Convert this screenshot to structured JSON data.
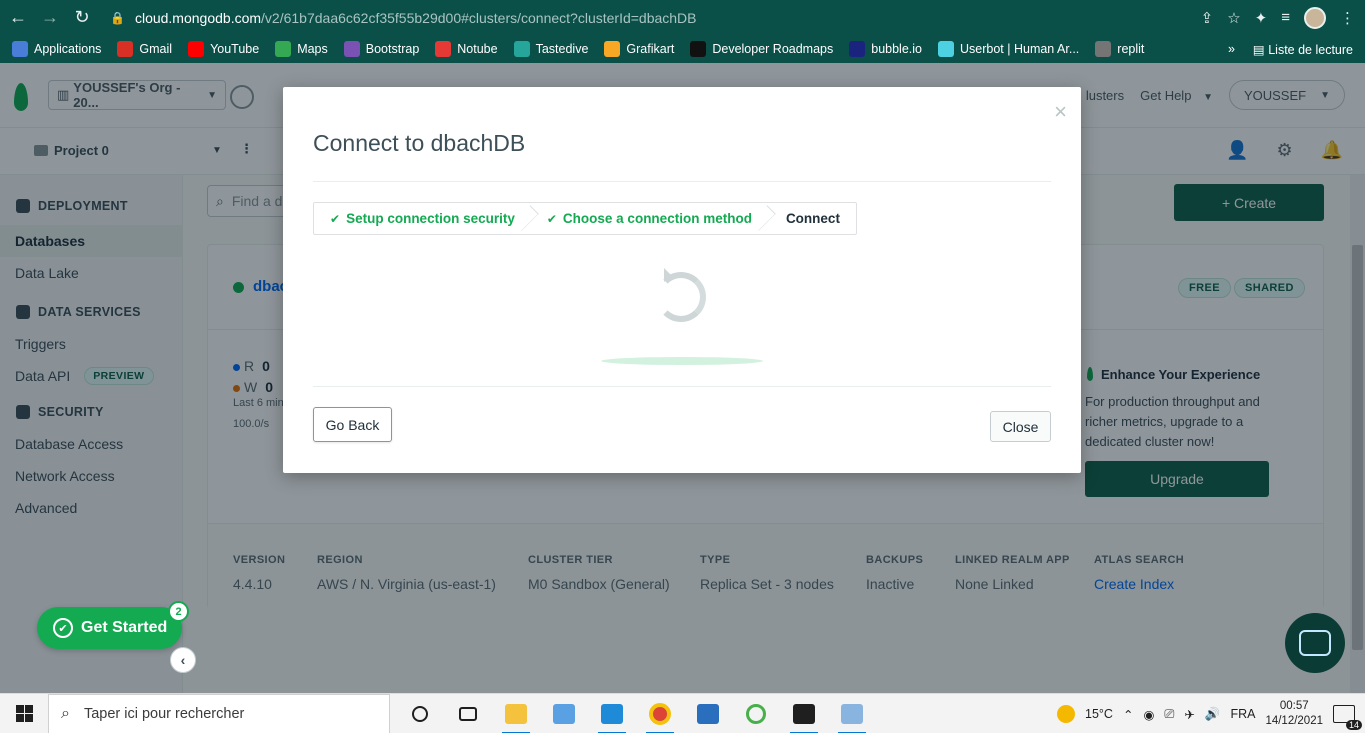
{
  "browser": {
    "url_host": "cloud.mongodb.com",
    "url_path": "/v2/61b7daa6c62cf35f55b29d00#clusters/connect?clusterId=dbachDB",
    "bookmarks": [
      {
        "label": "Applications",
        "color": "#4a7dd8"
      },
      {
        "label": "Gmail",
        "color": "#d93025"
      },
      {
        "label": "YouTube",
        "color": "#ff0000"
      },
      {
        "label": "Maps",
        "color": "#34a853"
      },
      {
        "label": "Bootstrap",
        "color": "#7952b3"
      },
      {
        "label": "Notube",
        "color": "#e53935"
      },
      {
        "label": "Tastedive",
        "color": "#26a69a"
      },
      {
        "label": "Grafikart",
        "color": "#f9a825"
      },
      {
        "label": "Developer Roadmaps",
        "color": "#111111"
      },
      {
        "label": "bubble.io",
        "color": "#1a237e"
      },
      {
        "label": "Userbot | Human Ar...",
        "color": "#4dd0e1"
      },
      {
        "label": "replit",
        "color": "#757575"
      }
    ],
    "reading_list": "Liste de lecture",
    "more": "»"
  },
  "header": {
    "org": "YOUSSEF's Org - 20...",
    "clusters_partial": "lusters",
    "get_help": "Get Help",
    "user": "YOUSSEF"
  },
  "project": {
    "name": "Project 0"
  },
  "sidebar": {
    "deployment": "DEPLOYMENT",
    "databases": "Databases",
    "data_lake": "Data Lake",
    "data_services": "DATA SERVICES",
    "triggers": "Triggers",
    "data_api": "Data API",
    "preview": "PREVIEW",
    "security": "SECURITY",
    "database_access": "Database Access",
    "network_access": "Network Access",
    "advanced": "Advanced"
  },
  "get_started": {
    "label": "Get Started",
    "count": "2"
  },
  "main": {
    "search_placeholder": "Find a d",
    "create": "Create",
    "cluster_name_partial": "dbac",
    "free": "FREE",
    "shared": "SHARED",
    "metric_r_label": "R",
    "metric_r_value": "0",
    "metric_w_label": "W",
    "metric_w_value": "0",
    "last_6": "Last 6 min",
    "rate": "100.0/s",
    "enhance_title": "Enhance Your Experience",
    "enhance_text": "For production throughput and richer metrics, upgrade to a dedicated cluster now!",
    "upgrade": "Upgrade",
    "footer": [
      {
        "key": "VERSION",
        "value": "4.4.10",
        "link": false
      },
      {
        "key": "REGION",
        "value": "AWS / N. Virginia (us-east-1)",
        "link": false
      },
      {
        "key": "CLUSTER TIER",
        "value": "M0 Sandbox (General)",
        "link": false
      },
      {
        "key": "TYPE",
        "value": "Replica Set - 3 nodes",
        "link": false
      },
      {
        "key": "BACKUPS",
        "value": "Inactive",
        "link": false
      },
      {
        "key": "LINKED REALM APP",
        "value": "None Linked",
        "link": false
      },
      {
        "key": "ATLAS SEARCH",
        "value": "Create Index",
        "link": true
      }
    ]
  },
  "modal": {
    "title": "Connect to dbachDB",
    "step1": "Setup connection security",
    "step2": "Choose a connection method",
    "step3": "Connect",
    "go_back": "Go Back",
    "close": "Close",
    "close_x": "×"
  },
  "taskbar": {
    "search_placeholder": "Taper ici pour rechercher",
    "weather": "15°C",
    "lang": "FRA",
    "time": "00:57",
    "date": "14/12/2021",
    "notif_count": "14"
  }
}
